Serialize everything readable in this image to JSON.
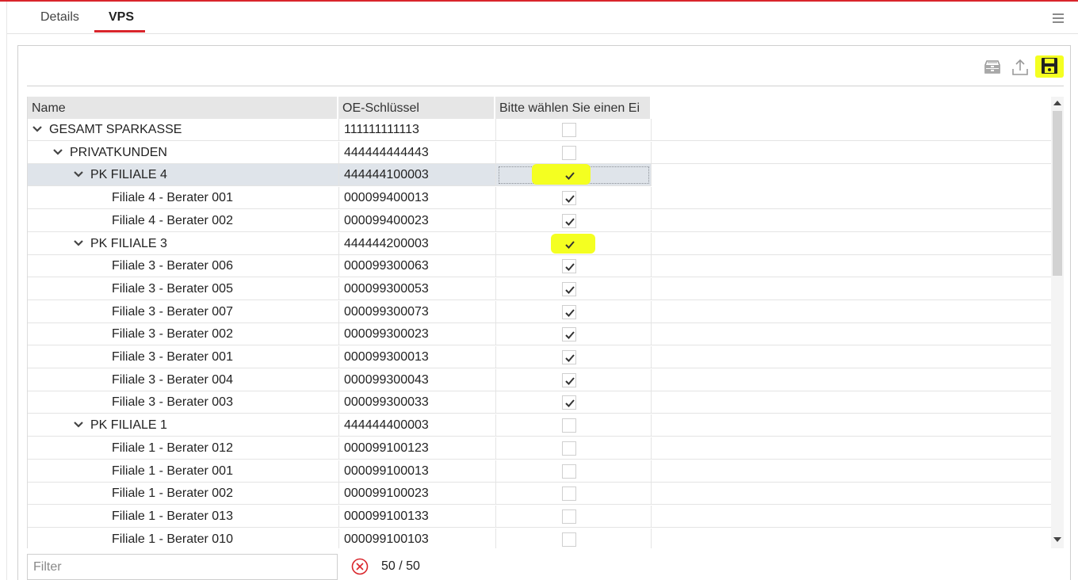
{
  "tabs": [
    {
      "label": "Details",
      "active": false
    },
    {
      "label": "VPS",
      "active": true
    }
  ],
  "toolbar": {
    "icons": [
      "archive-icon",
      "upload-icon",
      "save-icon"
    ],
    "highlight_color": "#f4ff21"
  },
  "table": {
    "columns": [
      "Name",
      "OE-Schlüssel",
      "Bitte wählen Sie einen Ei"
    ],
    "rows": [
      {
        "name": "GESAMT SPARKASSE",
        "key": "111111111113",
        "level": 0,
        "expandable": true,
        "checked": false
      },
      {
        "name": "PRIVATKUNDEN",
        "key": "444444444443",
        "level": 1,
        "expandable": true,
        "checked": false
      },
      {
        "name": "PK FILIALE 4",
        "key": "444444100003",
        "level": 2,
        "expandable": true,
        "checked": true,
        "selected": true,
        "highlighted": true
      },
      {
        "name": "Filiale 4 - Berater 001",
        "key": "000099400013",
        "level": 3,
        "expandable": false,
        "checked": true
      },
      {
        "name": "Filiale 4 - Berater 002",
        "key": "000099400023",
        "level": 3,
        "expandable": false,
        "checked": true
      },
      {
        "name": "PK FILIALE 3",
        "key": "444444200003",
        "level": 2,
        "expandable": true,
        "checked": true,
        "highlighted": true
      },
      {
        "name": "Filiale 3 - Berater 006",
        "key": "000099300063",
        "level": 3,
        "expandable": false,
        "checked": true
      },
      {
        "name": "Filiale 3 - Berater 005",
        "key": "000099300053",
        "level": 3,
        "expandable": false,
        "checked": true
      },
      {
        "name": "Filiale 3 - Berater 007",
        "key": "000099300073",
        "level": 3,
        "expandable": false,
        "checked": true
      },
      {
        "name": "Filiale 3 - Berater 002",
        "key": "000099300023",
        "level": 3,
        "expandable": false,
        "checked": true
      },
      {
        "name": "Filiale 3 - Berater 001",
        "key": "000099300013",
        "level": 3,
        "expandable": false,
        "checked": true
      },
      {
        "name": "Filiale 3 - Berater 004",
        "key": "000099300043",
        "level": 3,
        "expandable": false,
        "checked": true
      },
      {
        "name": "Filiale 3 - Berater 003",
        "key": "000099300033",
        "level": 3,
        "expandable": false,
        "checked": true
      },
      {
        "name": "PK FILIALE 1",
        "key": "444444400003",
        "level": 2,
        "expandable": true,
        "checked": false
      },
      {
        "name": "Filiale 1 - Berater 012",
        "key": "000099100123",
        "level": 3,
        "expandable": false,
        "checked": false
      },
      {
        "name": "Filiale 1 - Berater 001",
        "key": "000099100013",
        "level": 3,
        "expandable": false,
        "checked": false
      },
      {
        "name": "Filiale 1 - Berater 002",
        "key": "000099100023",
        "level": 3,
        "expandable": false,
        "checked": false
      },
      {
        "name": "Filiale 1 - Berater 013",
        "key": "000099100133",
        "level": 3,
        "expandable": false,
        "checked": false
      },
      {
        "name": "Filiale 1 - Berater 010",
        "key": "000099100103",
        "level": 3,
        "expandable": false,
        "checked": false
      }
    ]
  },
  "filter": {
    "placeholder": "Filter",
    "value": ""
  },
  "count": "50 / 50",
  "colors": {
    "accent": "#d9252b",
    "clear_icon": "#d9252b"
  }
}
